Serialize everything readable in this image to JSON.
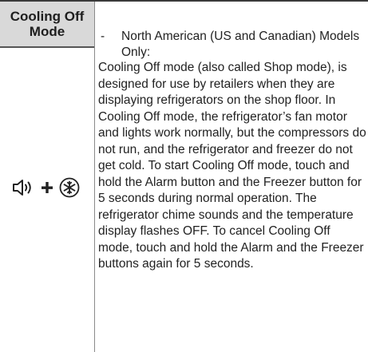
{
  "table": {
    "header": "Cooling Off Mode",
    "row": {
      "icons": [
        "speaker-icon",
        "plus-icon",
        "snowflake-icon"
      ],
      "bullet_dash": "-",
      "bullet": "North American (US and Canadian) Models Only:",
      "body": "Cooling Off mode (also called Shop mode), is designed for use by retailers when they are displaying refrigerators on the shop floor. In Cooling Off mode, the refrigerator’s fan motor and lights work normally, but the compressors do not run, and the refrigerator and freezer do not get cold. To start Cooling Off mode, touch and hold the Alarm button and the Freezer button for 5 seconds during normal operation. The refrigerator chime sounds and the temperature display flashes OFF. To cancel Cooling Off mode, touch and hold the Alarm and the Freezer buttons again for 5 seconds."
    }
  }
}
